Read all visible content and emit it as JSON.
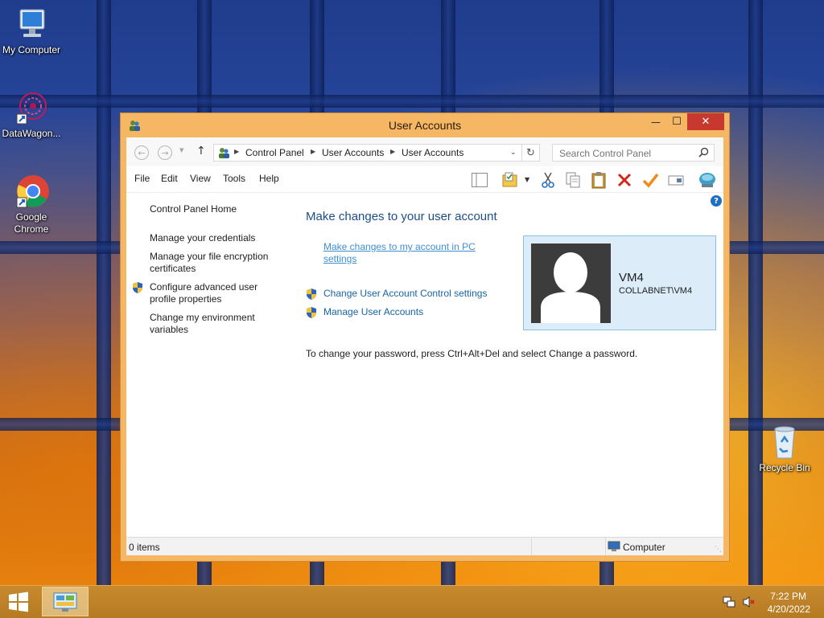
{
  "desktop": {
    "icons": [
      {
        "label": "My Computer"
      },
      {
        "label": "DataWagon..."
      },
      {
        "label": "Google Chrome"
      },
      {
        "label": "Recycle Bin"
      }
    ]
  },
  "window": {
    "title": "User Accounts",
    "controls": {
      "minimize": "—",
      "maximize": "☐",
      "close": "✕"
    },
    "address": {
      "crumbs": [
        "Control Panel",
        "User Accounts",
        "User Accounts"
      ]
    },
    "search": {
      "placeholder": "Search Control Panel"
    },
    "menu": [
      "File",
      "Edit",
      "View",
      "Tools",
      "Help"
    ],
    "toolbar_icons": [
      "layout-icon",
      "folder-options-icon",
      "cut-icon",
      "copy-icon",
      "paste-icon",
      "delete-icon",
      "properties-check-icon",
      "rename-icon",
      "network-globe-icon"
    ],
    "left_nav": {
      "home": "Control Panel Home",
      "links": [
        "Manage your credentials",
        "Manage your file encryption certificates",
        "Configure advanced user profile properties",
        "Change my environment variables"
      ]
    },
    "main": {
      "heading": "Make changes to your user account",
      "pc_settings_link": "Make changes to my account in PC settings",
      "uac_link": "Change User Account Control settings",
      "manage_link": "Manage User Accounts",
      "info": "To change your password, press Ctrl+Alt+Del and select Change a password."
    },
    "user": {
      "name": "VM4",
      "domain": "COLLABNET\\VM4"
    },
    "status": {
      "items": "0 items",
      "location": "Computer"
    }
  },
  "taskbar": {
    "time": "7:22 PM",
    "date": "4/20/2022"
  },
  "colors": {
    "accent_link": "#1664a8",
    "window_frame": "#f6b764",
    "close_button": "#c7392e",
    "user_card": "#dcecf8"
  }
}
